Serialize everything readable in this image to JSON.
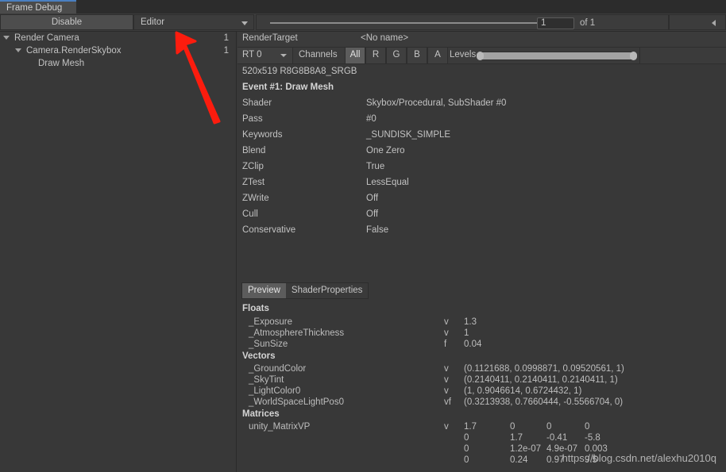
{
  "window": {
    "tab_label": "Frame Debug",
    "accent_color": "#4a7fc1"
  },
  "toolbar": {
    "disable_label": "Disable",
    "target_dropdown_value": "Editor",
    "dropdown_caret_icon": "chevron-down-icon",
    "event_index_value": "1",
    "event_total_label": "of 1",
    "prev_icon": "triangle-left-icon"
  },
  "tree": {
    "items": [
      {
        "label": "Render Camera",
        "count": "1",
        "depth": 0,
        "expanded": true
      },
      {
        "label": "Camera.RenderSkybox",
        "count": "1",
        "depth": 1,
        "expanded": true
      },
      {
        "label": "Draw Mesh",
        "count": "",
        "depth": 2,
        "expanded": false
      }
    ]
  },
  "render_target": {
    "header_label": "RenderTarget",
    "header_value": "<No name>",
    "rt_dropdown_value": "RT 0",
    "channels_label": "Channels",
    "channels": [
      {
        "label": "All",
        "selected": true
      },
      {
        "label": "R",
        "selected": false
      },
      {
        "label": "G",
        "selected": false
      },
      {
        "label": "B",
        "selected": false
      },
      {
        "label": "A",
        "selected": false
      }
    ],
    "levels_label": "Levels",
    "size_format": "520x519 R8G8B8A8_SRGB"
  },
  "event": {
    "title": "Event #1: Draw Mesh",
    "properties": [
      {
        "key": "Shader",
        "value": "Skybox/Procedural, SubShader #0"
      },
      {
        "key": "Pass",
        "value": "#0"
      },
      {
        "key": "Keywords",
        "value": "_SUNDISK_SIMPLE"
      },
      {
        "key": "Blend",
        "value": "One Zero"
      },
      {
        "key": "ZClip",
        "value": "True"
      },
      {
        "key": "ZTest",
        "value": "LessEqual"
      },
      {
        "key": "ZWrite",
        "value": "Off"
      },
      {
        "key": "Cull",
        "value": "Off"
      },
      {
        "key": "Conservative",
        "value": "False"
      }
    ]
  },
  "subtabs": [
    {
      "label": "Preview",
      "selected": true
    },
    {
      "label": "ShaderProperties",
      "selected": false
    }
  ],
  "shader_properties": {
    "floats_title": "Floats",
    "floats": [
      {
        "name": "_Exposure",
        "type": "v",
        "value": "1.3"
      },
      {
        "name": "_AtmosphereThickness",
        "type": "v",
        "value": "1"
      },
      {
        "name": "_SunSize",
        "type": "f",
        "value": "0.04"
      }
    ],
    "vectors_title": "Vectors",
    "vectors": [
      {
        "name": "_GroundColor",
        "type": "v",
        "value": "(0.1121688, 0.0998871, 0.09520561, 1)"
      },
      {
        "name": "_SkyTint",
        "type": "v",
        "value": "(0.2140411, 0.2140411, 0.2140411, 1)"
      },
      {
        "name": "_LightColor0",
        "type": "v",
        "value": "(1, 0.9046614, 0.6724432, 1)"
      },
      {
        "name": "_WorldSpaceLightPos0",
        "type": "vf",
        "value": "(0.3213938, 0.7660444, -0.5566704, 0)"
      }
    ],
    "matrices_title": "Matrices",
    "matrices": [
      {
        "name": "unity_MatrixVP",
        "type": "v",
        "rows": [
          [
            "1.7",
            "0",
            "0",
            "0"
          ],
          [
            "0",
            "1.7",
            "-0.41",
            "-5.8"
          ],
          [
            "0",
            "1.2e-07",
            "4.9e-07",
            "0.003"
          ],
          [
            "0",
            "0.24",
            "0.97",
            "9.5"
          ]
        ]
      }
    ]
  },
  "annotation": {
    "arrow_color": "#fc1c0e",
    "arrow_name": "red-pointer-arrow"
  },
  "watermark": {
    "text": "https://blog.csdn.net/alexhu2010q"
  }
}
